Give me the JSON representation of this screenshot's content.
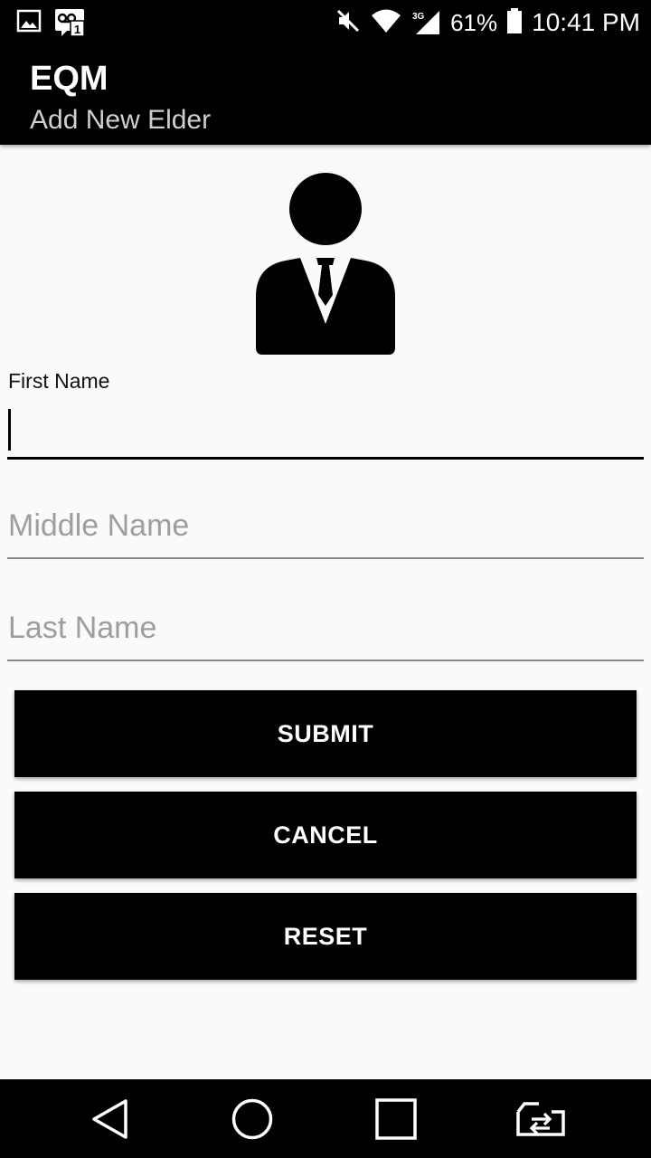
{
  "status_bar": {
    "icons_left": [
      "image-icon",
      "voicemail-notification-icon"
    ],
    "notification_badge": "1",
    "icons_right": [
      "mute-icon",
      "wifi-icon",
      "cell-signal-icon",
      "battery-icon"
    ],
    "network_type": "3G",
    "battery": "61%",
    "time": "10:41 PM"
  },
  "app_bar": {
    "title": "EQM",
    "subtitle": "Add New Elder"
  },
  "avatar": {
    "icon": "person-suit-icon"
  },
  "form": {
    "first_name": {
      "label": "First Name",
      "value": "",
      "placeholder": ""
    },
    "middle_name": {
      "value": "",
      "placeholder": "Middle Name"
    },
    "last_name": {
      "value": "",
      "placeholder": "Last Name"
    }
  },
  "buttons": {
    "submit": "SUBMIT",
    "cancel": "CANCEL",
    "reset": "RESET"
  },
  "nav_bar": {
    "icons": [
      "back-icon",
      "home-icon",
      "recents-icon",
      "switch-app-icon"
    ]
  },
  "colors": {
    "bar_background": "#000000",
    "page_background": "#fafafa",
    "button_background": "#000000",
    "button_text": "#ffffff",
    "placeholder": "#9e9e9e"
  }
}
